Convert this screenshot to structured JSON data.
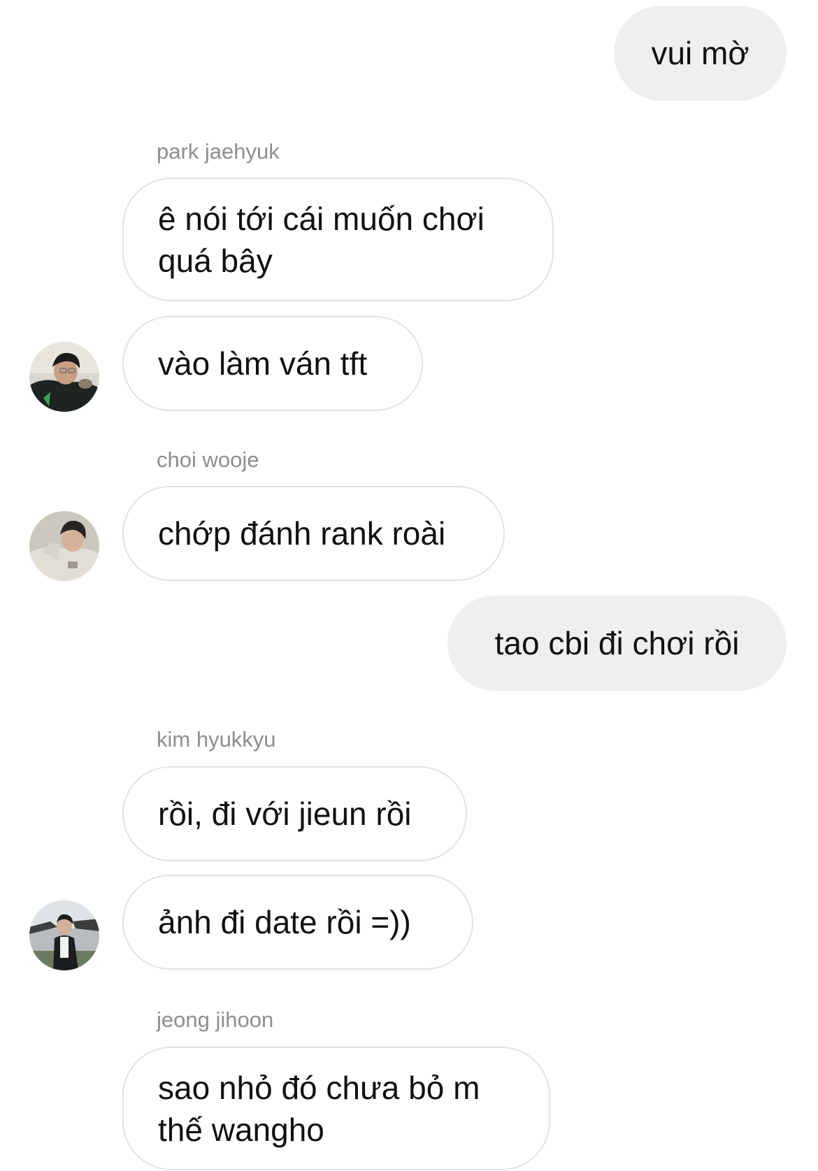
{
  "messages": [
    {
      "from": "me",
      "text": "vui mờ"
    },
    {
      "from": "park jaehyuk",
      "sender_label": "park jaehyuk",
      "text": "ê nói tới cái muốn chơi quá bây"
    },
    {
      "from": "park jaehyuk",
      "text": "vào làm ván tft"
    },
    {
      "from": "choi wooje",
      "sender_label": "choi wooje",
      "text": "chớp đánh rank roài"
    },
    {
      "from": "me",
      "text": "tao cbi đi chơi rồi"
    },
    {
      "from": "kim hyukkyu",
      "sender_label": "kim hyukkyu",
      "text": "rồi, đi với jieun rồi"
    },
    {
      "from": "kim hyukkyu",
      "text": "ảnh đi date rồi =))"
    },
    {
      "from": "jeong jihoon",
      "sender_label": "jeong jihoon",
      "text": "sao nhỏ đó chưa bỏ m thế wangho"
    }
  ],
  "avatars": {
    "park_jaehyuk": "avatar-photo-park-jaehyuk",
    "choi_wooje": "avatar-photo-choi-wooje",
    "kim_hyukkyu": "avatar-photo-kim-hyukkyu"
  },
  "colors": {
    "outgoing_bubble": "#efefef",
    "incoming_border": "#e3e3e3",
    "sender_name": "#8e8e8e"
  }
}
